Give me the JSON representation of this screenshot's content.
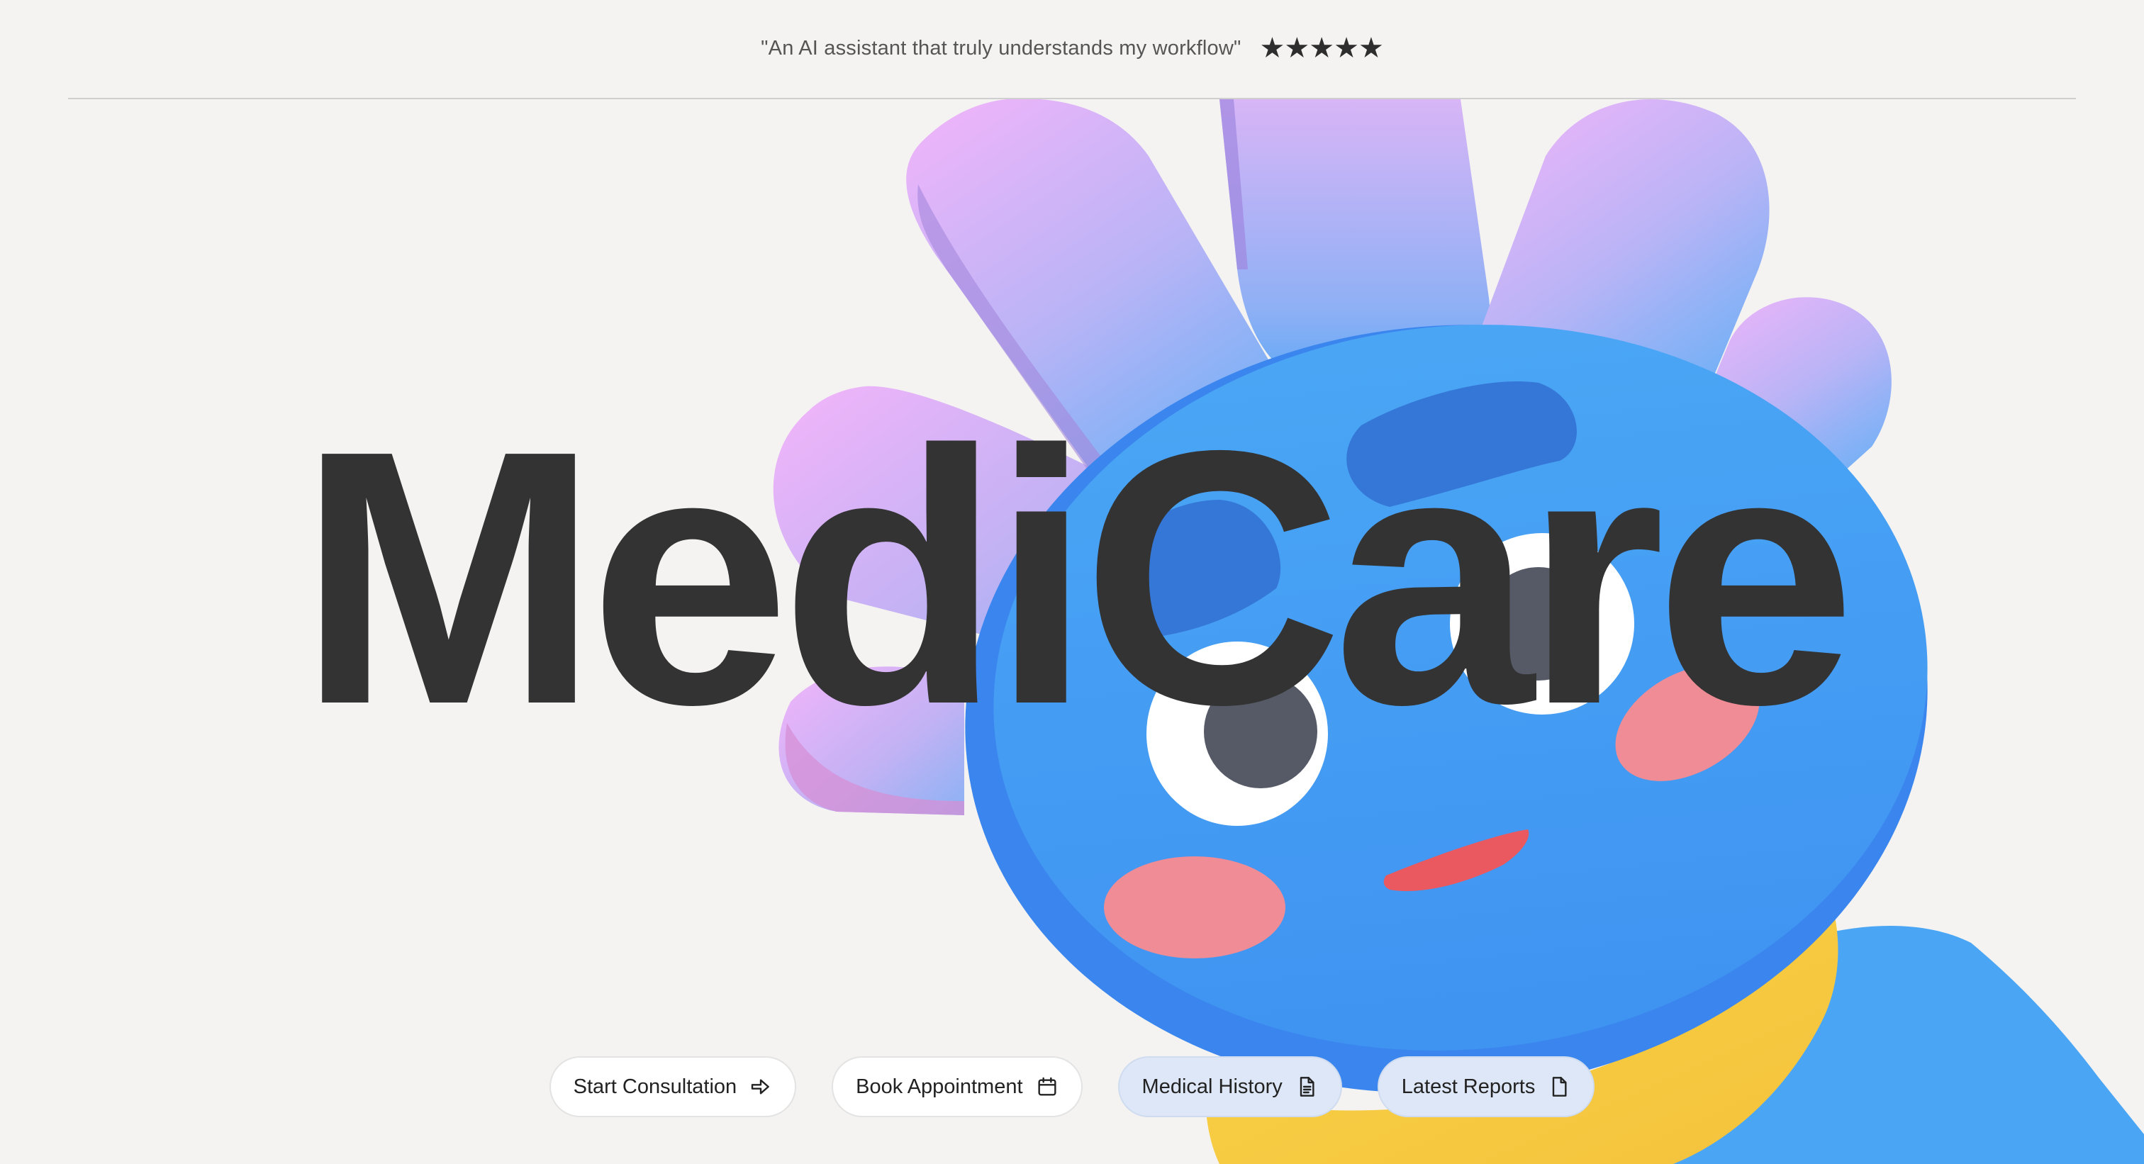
{
  "testimonial": {
    "quote": "\"An AI assistant that truly understands my workflow\"",
    "rating": 5,
    "stars": [
      "★",
      "★",
      "★",
      "★",
      "★"
    ]
  },
  "brand": {
    "title": "MediCare"
  },
  "actions": [
    {
      "label": "Start Consultation",
      "icon": "arrow-right-icon"
    },
    {
      "label": "Book Appointment",
      "icon": "calendar-icon"
    },
    {
      "label": "Medical History",
      "icon": "document-lines-icon"
    },
    {
      "label": "Latest Reports",
      "icon": "document-icon"
    }
  ],
  "colors": {
    "background": "#f4f3f1",
    "text": "#333333",
    "mascot_blue": "#4aa6f5",
    "petal_pink": "#f2b6f9",
    "scarf_yellow": "#f7d046",
    "cheek_pink": "#ef8c95",
    "pill_tint": "#dde7f7"
  }
}
